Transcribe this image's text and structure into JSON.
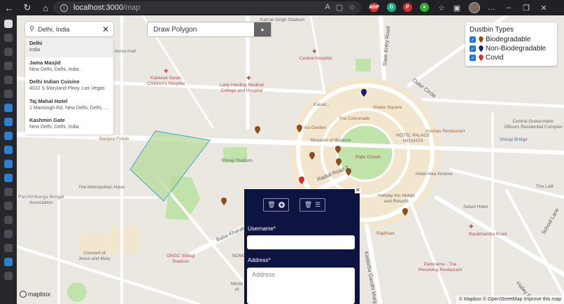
{
  "browser": {
    "url_host": "localhost:3000",
    "url_path": "/map"
  },
  "search": {
    "value": "Delhi, India",
    "suggestions": [
      {
        "title": "Delhi",
        "subtitle": "India"
      },
      {
        "title": "Jama Masjid",
        "subtitle": "New Delhi, Delhi, India"
      },
      {
        "title": "Delhi Indian Cuisine",
        "subtitle": "4022 S Maryland Pkwy, Las Vegas"
      },
      {
        "title": "Taj Mahal Hotel",
        "subtitle": "1 Mansingh Rd, New Delhi, Delhi, I..."
      },
      {
        "title": "Kashmiri Gate",
        "subtitle": "New Delhi, Delhi, India"
      }
    ]
  },
  "draw": {
    "label": "Draw Polygon"
  },
  "legend": {
    "title": "Dustbin Types",
    "items": [
      {
        "label": "Biodegradable",
        "color": "#8b4f1e"
      },
      {
        "label": "Non-Biodegradable",
        "color": "#1c1d6e"
      },
      {
        "label": "Covid",
        "color": "#d62c2c"
      }
    ]
  },
  "form": {
    "username_label": "Username*",
    "address_label": "Address*",
    "address_placeholder": "Address"
  },
  "map_labels": {
    "karnat": "Karnat Singh Stadium",
    "central_hospital": "Central Hospital",
    "kalawati": "Kalawati Saran\nChildren's Hospital",
    "lady_harding": "Lady Harding Medical\nCollege and Hospital",
    "tomm": "tomm mall",
    "state_entry": "State Entry Road",
    "outer_circle": "Outer Circle",
    "shake_square": "Shake Square",
    "colonnade": "The Colonnade",
    "kaiser": "Kaiser...",
    "central_gov": "Central Government\nOfficers Residential Complex",
    "keshav": "Keshav Restaurant",
    "shivaji_bridge": "Shivaji Bridge",
    "palace": "HOTEL PALACE\nHEIGHTS",
    "ina": "Ina Garden",
    "museum": "Museum of Illusions",
    "rajiv": "Rajiv Chowk",
    "banjara": "Banjara Foods",
    "shivaji_stadium": "Shivaji Stadium",
    "radial": "Radial Road 2",
    "hotel_alka": "Hotel Alka Annexe",
    "metropolitan": "The Metropolitan Hotel",
    "the_lalit": "The Lalit",
    "holiday_inn": "Holiday Inn Hotels\nand Resorts",
    "bengali": "Paschimbanga Bengal\nAssociation",
    "select_hotel": "Select Hotel",
    "baba_kharak": "Baba Kharak Singh Marg",
    "rajdhani": "Rajdhani",
    "barakhamba": "Barakhamba Road",
    "school_lane": "School Lane",
    "convent": "Convent of\nJesus and Mary",
    "ongc": "ONGC Shivaji\nStadium",
    "parikrama": "Parikrama - The\nRevolving Restaurant",
    "ministry": "Minist\nAf",
    "hailey": "Hailey R",
    "kasturba": "Kasturba Gandhi Marg",
    "ndmc": "NDMC"
  },
  "footer": {
    "mapbox": "mapbox",
    "attribution": "© Mapbox © OpenStreetMap  Improve this map"
  },
  "colors": {
    "panel": "#0d1442",
    "park": "#bfe3a8",
    "polygon_stroke": "#3fa7c8",
    "polygon_fill": "#b7d99a"
  }
}
